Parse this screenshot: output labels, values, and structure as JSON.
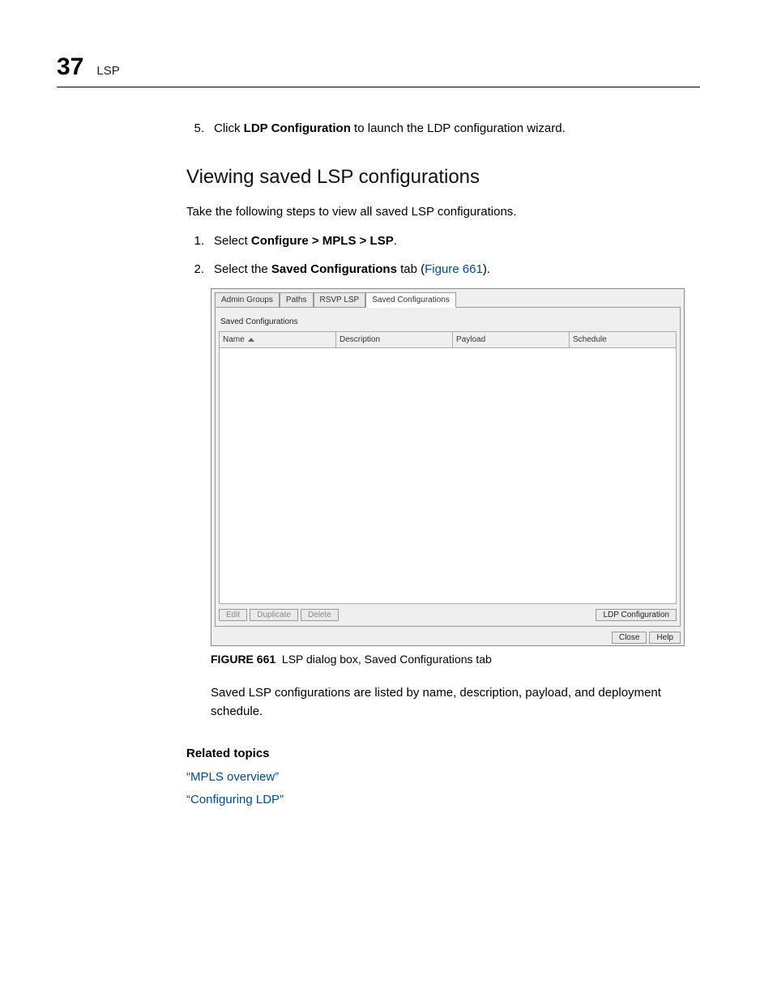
{
  "header": {
    "chapter_number": "37",
    "chapter_title": "LSP"
  },
  "pre_step": {
    "num": "5.",
    "before": "Click ",
    "bold": "LDP Configuration",
    "after": " to launch the LDP configuration wizard."
  },
  "section_heading": "Viewing saved LSP configurations",
  "intro": "Take the following steps to view all saved LSP configurations.",
  "steps": [
    {
      "num": "1.",
      "before": "Select ",
      "bold": "Configure > MPLS > LSP",
      "after": "."
    },
    {
      "num": "2.",
      "before": "Select the ",
      "bold": "Saved Configurations",
      "after": " tab (",
      "link": "Figure 661",
      "tail": ")."
    }
  ],
  "dialog": {
    "tabs": {
      "admin_groups": "Admin Groups",
      "paths": "Paths",
      "rsvp_lsp": "RSVP LSP",
      "saved_configurations": "Saved Configurations"
    },
    "panel_title": "Saved Configurations",
    "columns": {
      "name": "Name",
      "description": "Description",
      "payload": "Payload",
      "schedule": "Schedule"
    },
    "buttons": {
      "edit": "Edit",
      "duplicate": "Duplicate",
      "delete": "Delete",
      "ldp_configuration": "LDP Configuration",
      "close": "Close",
      "help": "Help"
    }
  },
  "figure_caption": {
    "label": "FIGURE 661",
    "text": "LSP dialog box, Saved Configurations tab"
  },
  "after_figure": "Saved LSP configurations are listed by name, description, payload, and deployment schedule.",
  "related": {
    "heading": "Related topics",
    "link1": "“MPLS overview”",
    "link2": "“Configuring LDP”"
  }
}
